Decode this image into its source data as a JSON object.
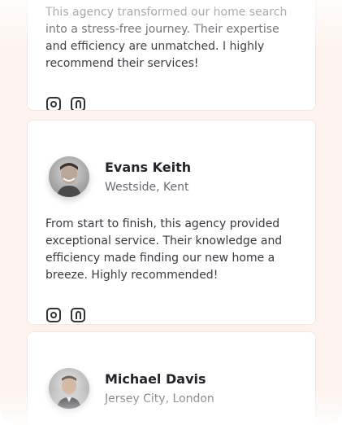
{
  "testimonials": [
    {
      "quote": "This agency transformed our home search into a stress-free journey. Their expertise and efficiency are unmatched. I highly recommend their services!",
      "socials": [
        "instagram-icon",
        "facebook-icon"
      ]
    },
    {
      "name": "Evans Keith",
      "location": "Westside, Kent",
      "quote": "From start to finish, this agency provided exceptional service. Their knowledge and efficiency made finding our new home a breeze. Highly recommended!",
      "socials": [
        "instagram-icon",
        "facebook-icon"
      ]
    },
    {
      "name": "Michael Davis",
      "location": "Jersey City, London"
    }
  ],
  "colors": {
    "background": "#fdf3ee",
    "card": "#ffffff",
    "text": "#2e2e33",
    "muted": "#6a6a72"
  }
}
